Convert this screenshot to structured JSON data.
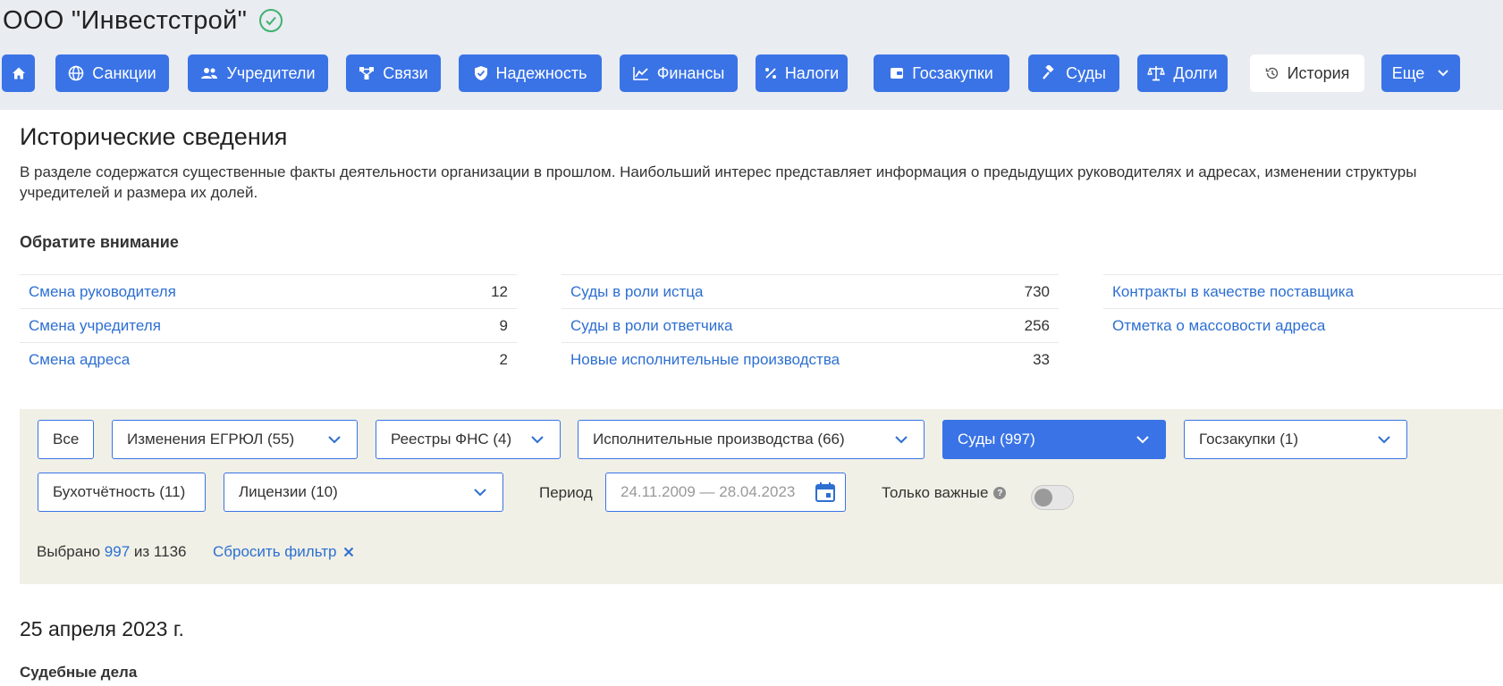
{
  "company": {
    "name": "ООО \"Инвестстрой\"",
    "verified_icon": "check-circle-icon"
  },
  "nav": [
    {
      "icon": "home-icon",
      "label": ""
    },
    {
      "icon": "globe-icon",
      "label": "Санкции"
    },
    {
      "icon": "users-icon",
      "label": "Учредители"
    },
    {
      "icon": "network-icon",
      "label": "Связи"
    },
    {
      "icon": "shield-check-icon",
      "label": "Надежность"
    },
    {
      "icon": "chart-icon",
      "label": "Финансы"
    },
    {
      "icon": "percent-icon",
      "label": "Налоги"
    },
    {
      "icon": "wallet-icon",
      "label": "Госзакупки"
    },
    {
      "icon": "gavel-icon",
      "label": "Суды"
    },
    {
      "icon": "scales-icon",
      "label": "Долги"
    },
    {
      "icon": "history-icon",
      "label": "История",
      "active": true
    },
    {
      "icon": "chevron-down-icon",
      "label": "Еще"
    }
  ],
  "section": {
    "title": "Исторические сведения",
    "description_line1": "В разделе содержатся существенные факты деятельности организации в прошлом. Наибольший интерес представляет информация о предыдущих руководителях и адресах, изменении структуры",
    "description_line2": "учредителей и размера их долей."
  },
  "attention": {
    "title": "Обратите внимание",
    "columns": [
      [
        {
          "label": "Смена руководителя",
          "value": "12"
        },
        {
          "label": "Смена учредителя",
          "value": "9"
        },
        {
          "label": "Смена адреса",
          "value": "2"
        }
      ],
      [
        {
          "label": "Суды в роли истца",
          "value": "730"
        },
        {
          "label": "Суды в роли ответчика",
          "value": "256"
        },
        {
          "label": "Новые исполнительные производства",
          "value": "33"
        }
      ],
      [
        {
          "label": "Контракты в качестве поставщика",
          "value": ""
        },
        {
          "label": "Отметка о массовости адреса",
          "value": ""
        }
      ]
    ]
  },
  "filters": {
    "all": "Все",
    "egrul": "Изменения ЕГРЮЛ (55)",
    "fns": "Реестры ФНС (4)",
    "exec": "Исполнительные производства (66)",
    "courts": "Суды (997)",
    "procurement": "Госзакупки (1)",
    "accounting": "Бухотчётность (11)",
    "licenses": "Лицензии (10)",
    "period_label": "Период",
    "period_placeholder": "24.11.2009 — 28.04.2023",
    "important_label": "Только важные",
    "important_on": false,
    "selected_prefix": "Выбрано",
    "selected_count": "997",
    "selected_mid": "из",
    "selected_total": "1136",
    "reset_label": "Сбросить фильтр"
  },
  "timeline": {
    "date": "25 апреля 2023 г.",
    "group": "Судебные дела"
  },
  "colors": {
    "accent": "#3a73e6",
    "link": "#2d6fd1",
    "filter_bg": "#f0f0e6",
    "verified": "#3db36e"
  }
}
